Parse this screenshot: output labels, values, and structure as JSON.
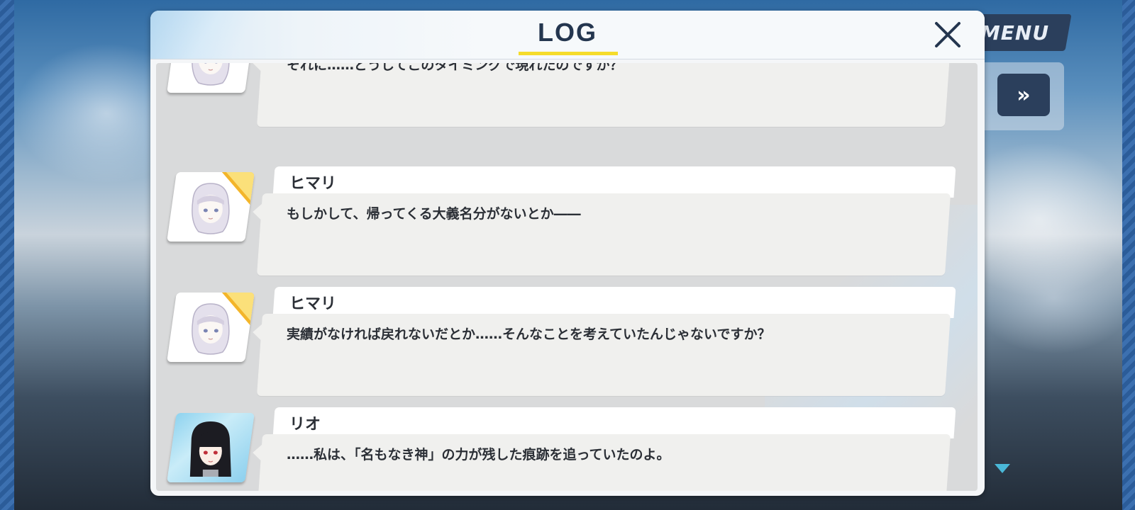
{
  "screen": {
    "menu_label": "MENU",
    "fast_forward_glyph": "»"
  },
  "dialog": {
    "title": "LOG",
    "close_icon": "close-icon"
  },
  "log": {
    "entries": [
      {
        "speaker": "",
        "avatar": "himari-portrait",
        "text": "それに……どうしてこのタイミングで現れたのですか？"
      },
      {
        "speaker": "ヒマリ",
        "avatar": "himari-portrait",
        "text": "もしかして、帰ってくる大義名分がないとか――"
      },
      {
        "speaker": "ヒマリ",
        "avatar": "himari-portrait",
        "text": "実績がなければ戻れないだとか……そんなことを考えていたんじゃないですか？"
      },
      {
        "speaker": "リオ",
        "avatar": "rio-portrait",
        "text": "……私は、「名もなき神」の力が残した痕跡を追っていたのよ。"
      }
    ]
  },
  "colors": {
    "accent_yellow": "#f5dc2a",
    "navy": "#24364f",
    "avatar_corner": "#f3b52a"
  }
}
